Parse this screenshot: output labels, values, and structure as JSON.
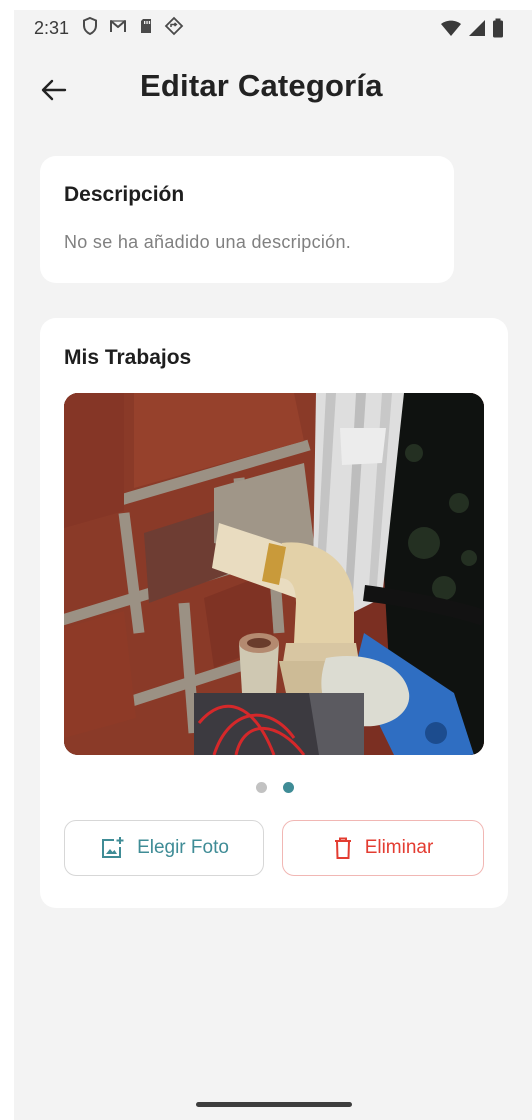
{
  "status_bar": {
    "time": "2:31",
    "left_icons": [
      "shield-icon",
      "gmail-icon",
      "sd-card-icon",
      "location-diamond-icon"
    ],
    "right_icons": [
      "wifi-icon",
      "signal-icon",
      "battery-icon"
    ]
  },
  "app_bar": {
    "back_icon": "arrow-left-icon",
    "title": "Editar Categoría"
  },
  "description_card": {
    "heading": "Descripción",
    "text": "No se ha añadido una descripción."
  },
  "works_card": {
    "heading": "Mis Trabajos",
    "photos_count": 2,
    "active_photo_index": 1,
    "choose_photo_label": "Elegir Foto",
    "choose_photo_icon": "add-photo-icon",
    "delete_label": "Eliminar",
    "delete_icon": "trash-icon"
  },
  "colors": {
    "accent": "#3f8c96",
    "danger": "#e33c31",
    "background": "#f3f3f3",
    "card": "#ffffff"
  }
}
